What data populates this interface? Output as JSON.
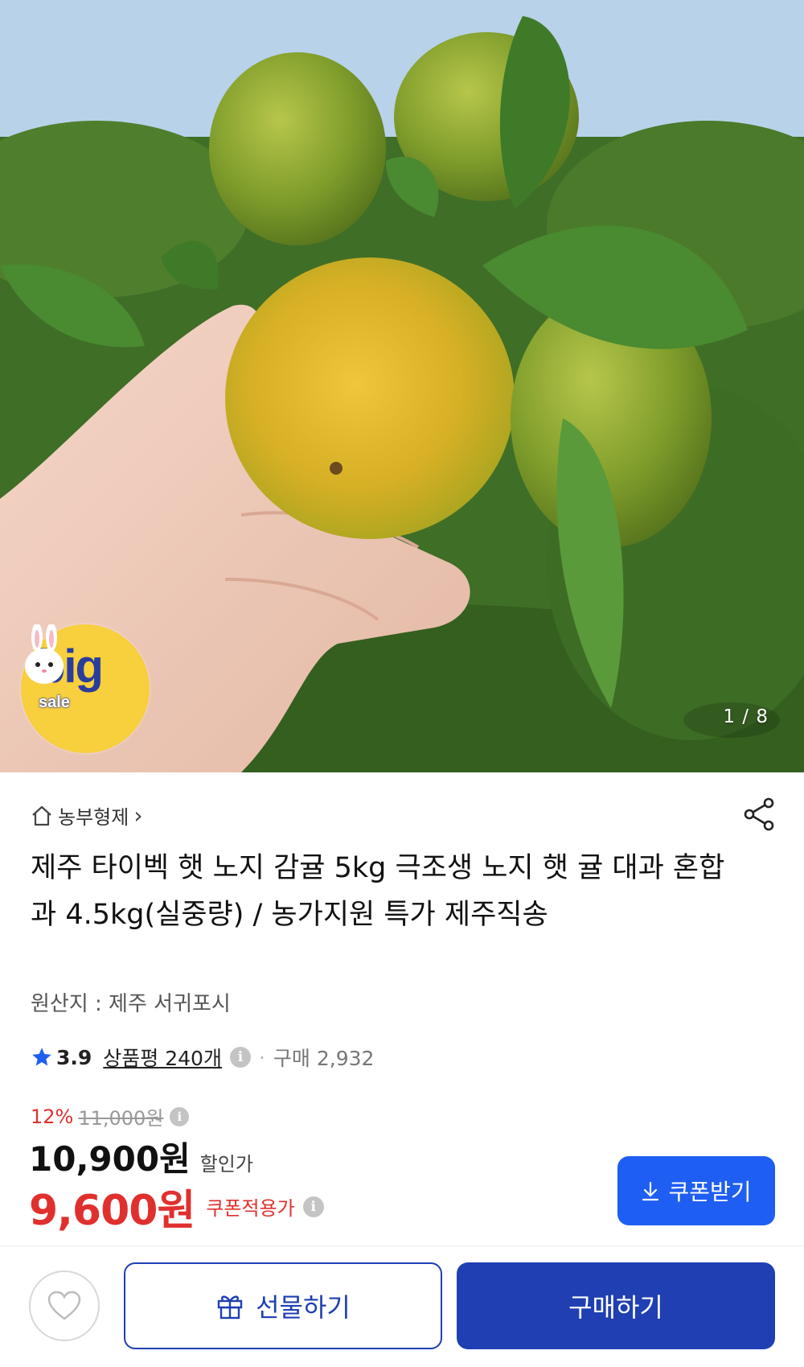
{
  "gallery": {
    "counter": "1 / 8",
    "badge": {
      "big": "big",
      "sale": "sale"
    }
  },
  "store": {
    "name": "농부형제",
    "chevron": "›"
  },
  "product": {
    "title": "제주 타이벡 햇 노지 감귤 5kg 극조생 노지 햇 귤 대과 혼합과 4.5kg(실중량) / 농가지원 특가 제주직송",
    "origin": "원산지 : 제주 서귀포시"
  },
  "rating": {
    "score": "3.9",
    "reviews": "상품평 240개",
    "purchase": "구매 2,932"
  },
  "price": {
    "discount_rate": "12%",
    "original": "11,000원",
    "sale_price": "10,900원",
    "sale_label": "할인가",
    "coupon_price": "9,600원",
    "coupon_label": "쿠폰적용가"
  },
  "actions": {
    "coupon": "쿠폰받기",
    "gift": "선물하기",
    "buy": "구매하기"
  },
  "colors": {
    "accent_blue": "#1f5ef2",
    "buy_blue": "#1f3fb3",
    "discount_red": "#e0302e"
  },
  "icons": [
    "home-icon",
    "share-icon",
    "star-icon",
    "info-icon",
    "download-icon",
    "heart-icon",
    "gift-icon"
  ]
}
